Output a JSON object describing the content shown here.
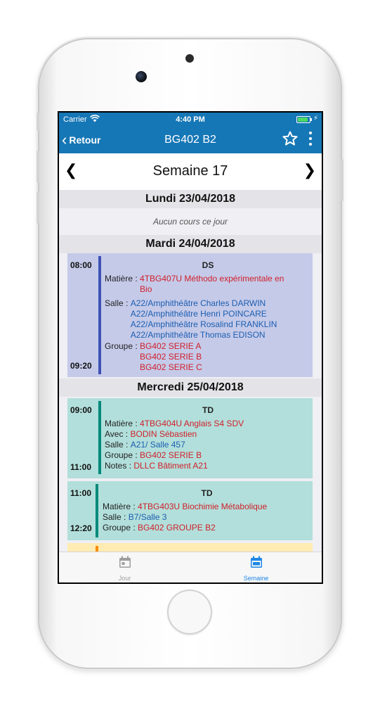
{
  "status": {
    "carrier": "Carrier",
    "time": "4:40 PM"
  },
  "nav": {
    "back_label": "Retour",
    "title": "BG402 B2"
  },
  "week": {
    "title": "Semaine 17"
  },
  "days": [
    {
      "header": "Lundi 23/04/2018",
      "no_course": "Aucun cours ce jour"
    },
    {
      "header": "Mardi 24/04/2018",
      "events": [
        {
          "start": "08:00",
          "end": "09:20",
          "type": "DS",
          "color": "#c5cae9",
          "bar_color": "#3f51b5",
          "matiere_label": "Matière :",
          "matiere": [
            "4TBG407U Méthodo expérimentale en",
            "Bio"
          ],
          "salle_label": "Salle :",
          "salles": [
            "A22/Amphithéâtre Charles DARWIN",
            "A22/Amphithéâtre Henri POINCARE",
            "A22/Amphithéâtre Rosalind FRANKLIN",
            "A22/Amphithéâtre Thomas EDISON"
          ],
          "groupe_label": "Groupe :",
          "groupes": [
            "BG402 SERIE A",
            "BG402 SERIE B",
            "BG402 SERIE C"
          ]
        }
      ]
    },
    {
      "header": "Mercredi 25/04/2018",
      "events": [
        {
          "start": "09:00",
          "end": "11:00",
          "type": "TD",
          "color": "#b2dfdb",
          "bar_color": "#00897b",
          "matiere_label": "Matière :",
          "matiere": "4TBG404U Anglais S4 SDV",
          "avec_label": "Avec :",
          "avec": "BODIN Sébastien",
          "salle_label": "Salle :",
          "salle": "A21/ Salle 457",
          "groupe_label": "Groupe :",
          "groupe": "BG402 SERIE B",
          "notes_label": "Notes :",
          "notes": "DLLC Bâtiment A21"
        },
        {
          "start": "11:00",
          "end": "12:20",
          "type": "TD",
          "color": "#b2dfdb",
          "bar_color": "#00897b",
          "matiere_label": "Matière :",
          "matiere": "4TBG403U Biochimie Métabolique",
          "salle_label": "Salle :",
          "salle": "B7/Salle 3",
          "groupe_label": "Groupe :",
          "groupe": "BG402 GROUPE B2"
        },
        {
          "color": "#ffecb3",
          "bar_color": "#fb8c00"
        }
      ]
    }
  ],
  "tabs": {
    "day_label": "Jour",
    "week_label": "Semaine"
  },
  "colors": {
    "nav_bar": "#1677b6",
    "tab_active": "#1e88e5",
    "tab_inactive": "#9e9e9e"
  }
}
